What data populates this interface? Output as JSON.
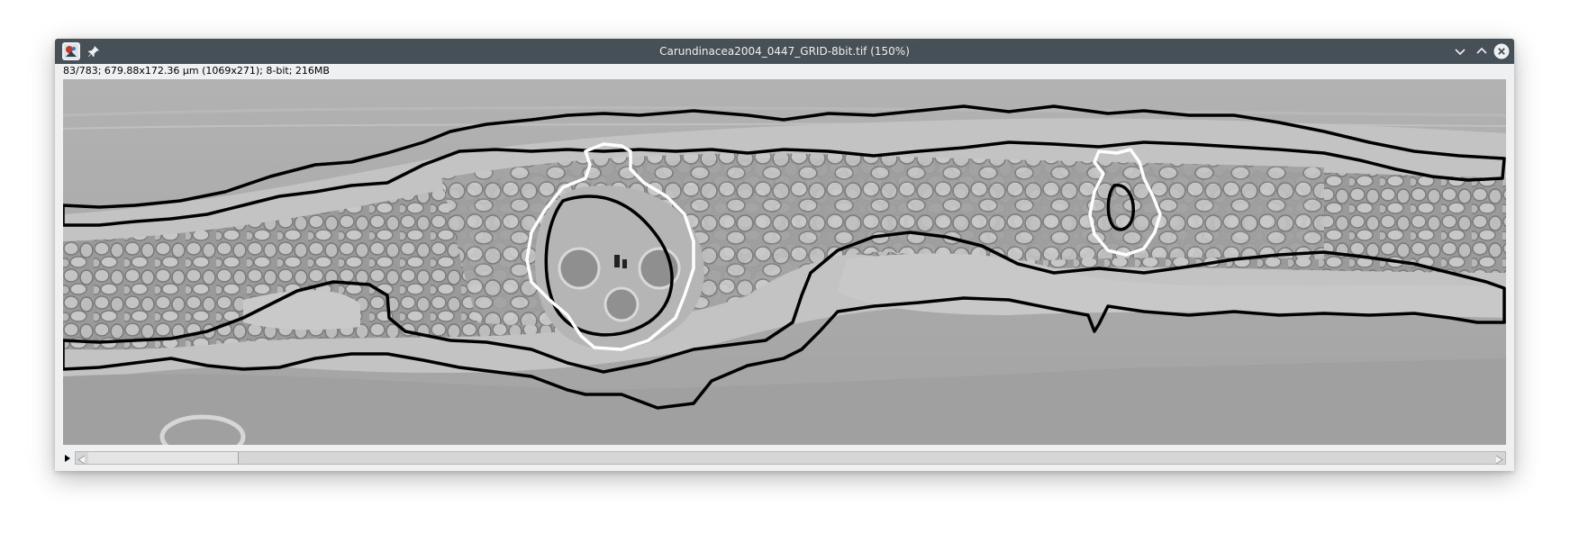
{
  "window": {
    "title": "Carundinacea2004_0447_GRID-8bit.tif (150%)",
    "status": "83/783; 679.88x172.36 µm (1069x271); 8-bit; 216MB"
  },
  "titlebar": {
    "app_icon": "imagej-icon",
    "pin_icon": "pin-icon",
    "buttons": [
      "minimize-icon",
      "maximize-icon",
      "close-icon"
    ]
  },
  "image": {
    "description_colors": {
      "background": "#a7a7a7",
      "roi_black": "#000000",
      "roi_white": "#ffffff"
    }
  },
  "scroll": {
    "position": 0.0
  },
  "colors": {
    "titlebar": "#475057",
    "window_bg": "#eff0f1",
    "close_button": "#eff0f1"
  }
}
